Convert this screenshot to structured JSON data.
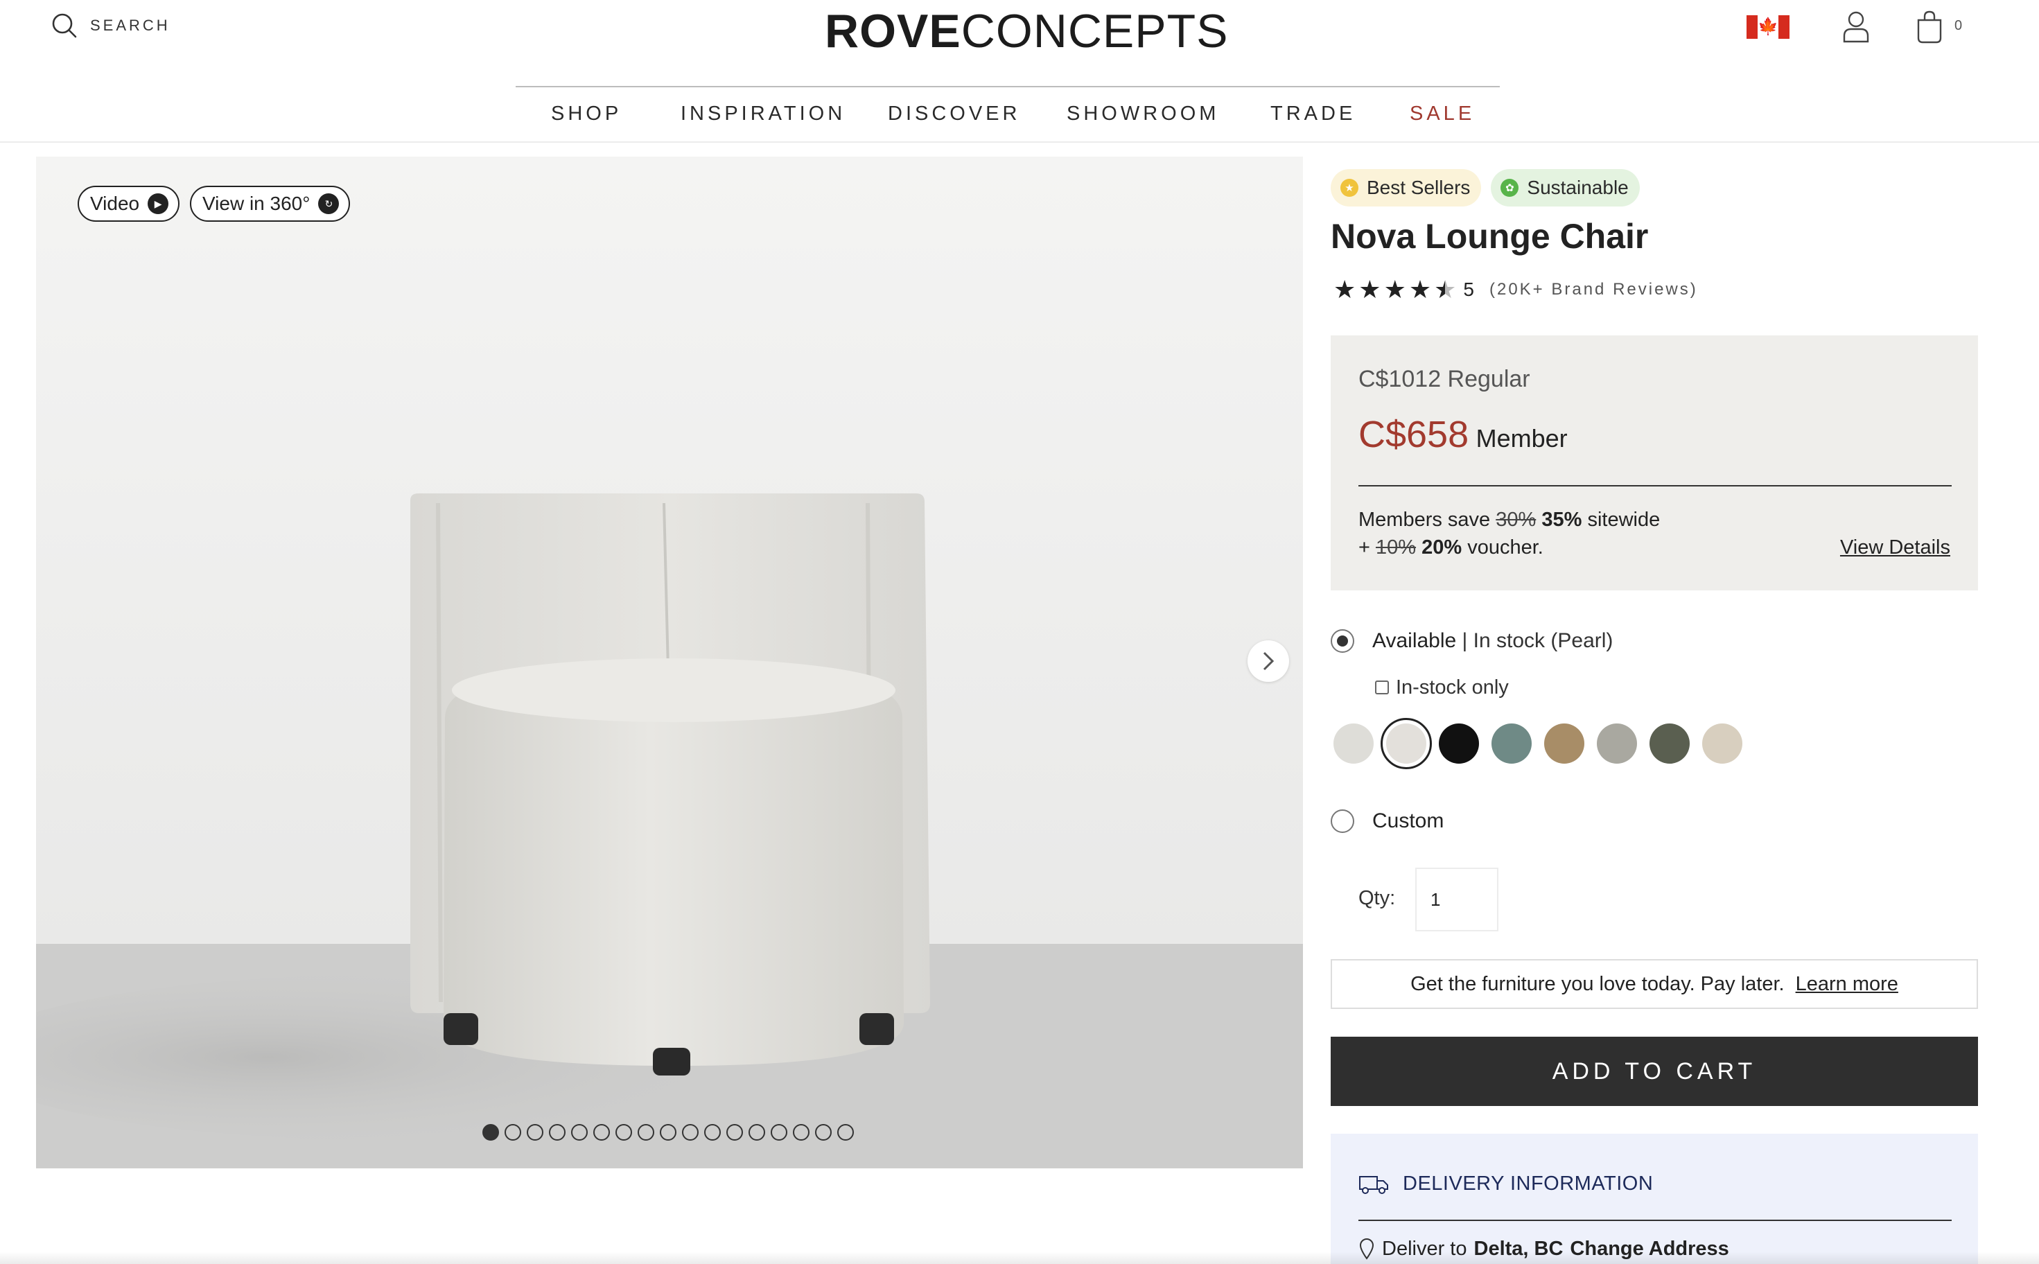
{
  "header": {
    "search_label": "SEARCH",
    "logo_bold": "ROVE",
    "logo_light": "CONCEPTS",
    "cart_count": "0",
    "nav": [
      {
        "label": "SHOP"
      },
      {
        "label": "INSPIRATION"
      },
      {
        "label": "DISCOVER"
      },
      {
        "label": "SHOWROOM"
      },
      {
        "label": "TRADE"
      },
      {
        "label": "SALE"
      }
    ]
  },
  "gallery": {
    "video_label": "Video",
    "view360_label": "View in 360°",
    "slide_count": 17,
    "active_slide": 1
  },
  "product": {
    "badges": [
      {
        "label": "Best Sellers"
      },
      {
        "label": "Sustainable"
      }
    ],
    "title": "Nova Lounge Chair",
    "rating": 4.5,
    "rating_display": "5",
    "reviews": "(20K+ Brand Reviews)",
    "price": {
      "regular": "C$1012 Regular",
      "member_price": "C$658",
      "member_label": "Member",
      "perk_prefix": "Members save",
      "perk_old": "30%",
      "perk_new": "35%",
      "perk_suffix": "sitewide",
      "voucher_prefix": "+",
      "voucher_old": "10%",
      "voucher_new": "20%",
      "voucher_suffix": "voucher.",
      "view_details": "View Details"
    },
    "availability": {
      "label": "Available",
      "sub": "| In stock (Pearl)",
      "instock_only": "In-stock only",
      "custom_label": "Custom"
    },
    "swatches": [
      {
        "name": "swatch-light-grey",
        "color": "#deddd8"
      },
      {
        "name": "swatch-pearl",
        "color": "#e3e0db",
        "selected": true
      },
      {
        "name": "swatch-black",
        "color": "#111111"
      },
      {
        "name": "swatch-sage",
        "color": "#6f8a86"
      },
      {
        "name": "swatch-camel",
        "color": "#a88d67"
      },
      {
        "name": "swatch-stone",
        "color": "#a9a8a0"
      },
      {
        "name": "swatch-olive",
        "color": "#5a5f50"
      },
      {
        "name": "swatch-oatmeal",
        "color": "#d8cfbf"
      }
    ],
    "qty_label": "Qty:",
    "qty_value": "1",
    "paylater_text": "Get the furniture you love today. Pay later.",
    "paylater_link": "Learn more",
    "add_to_cart": "ADD TO CART",
    "delivery": {
      "heading": "DELIVERY INFORMATION",
      "deliver_to": "Deliver to",
      "location": "Delta, BC",
      "change": "Change Address"
    }
  },
  "colors": {
    "accent_sale": "#a0392f",
    "member_price": "#a23a2e",
    "button_bg": "#2f2f2f",
    "price_box_bg": "#efeeeb",
    "delivery_bg": "#eef1fb"
  }
}
